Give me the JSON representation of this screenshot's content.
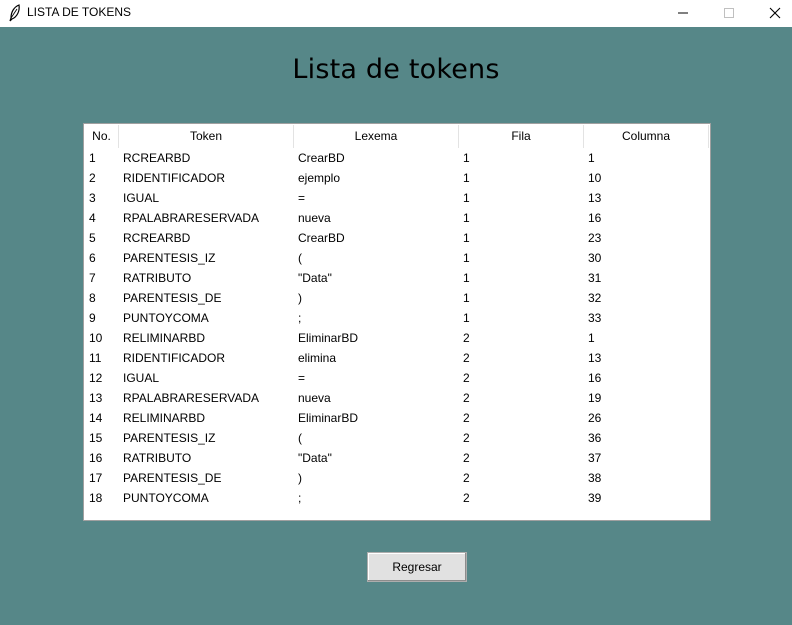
{
  "window": {
    "title": "LISTA DE TOKENS"
  },
  "heading": "Lista de tokens",
  "table": {
    "columns": [
      "No.",
      "Token",
      "Lexema",
      "Fila",
      "Columna"
    ],
    "rows": [
      [
        "1",
        "RCREARBD",
        "CrearBD",
        "1",
        "1"
      ],
      [
        "2",
        "RIDENTIFICADOR",
        "ejemplo",
        "1",
        "10"
      ],
      [
        "3",
        "IGUAL",
        "=",
        "1",
        "13"
      ],
      [
        "4",
        "RPALABRARESERVADA",
        "nueva",
        "1",
        "16"
      ],
      [
        "5",
        "RCREARBD",
        "CrearBD",
        "1",
        "23"
      ],
      [
        "6",
        "PARENTESIS_IZ",
        "(",
        "1",
        "30"
      ],
      [
        "7",
        "RATRIBUTO",
        "\"Data\"",
        "1",
        "31"
      ],
      [
        "8",
        "PARENTESIS_DE",
        ")",
        "1",
        "32"
      ],
      [
        "9",
        "PUNTOYCOMA",
        ";",
        "1",
        "33"
      ],
      [
        "10",
        "RELIMINARBD",
        "EliminarBD",
        "2",
        "1"
      ],
      [
        "11",
        "RIDENTIFICADOR",
        "elimina",
        "2",
        "13"
      ],
      [
        "12",
        "IGUAL",
        "=",
        "2",
        "16"
      ],
      [
        "13",
        "RPALABRARESERVADA",
        "nueva",
        "2",
        "19"
      ],
      [
        "14",
        "RELIMINARBD",
        "EliminarBD",
        "2",
        "26"
      ],
      [
        "15",
        "PARENTESIS_IZ",
        "(",
        "2",
        "36"
      ],
      [
        "16",
        "RATRIBUTO",
        "\"Data\"",
        "2",
        "37"
      ],
      [
        "17",
        "PARENTESIS_DE",
        ")",
        "2",
        "38"
      ],
      [
        "18",
        "PUNTOYCOMA",
        ";",
        "2",
        "39"
      ]
    ]
  },
  "back_button": "Regresar",
  "icons": {
    "app": "feather-icon",
    "minimize": "minimize-icon",
    "maximize": "maximize-icon",
    "close": "close-icon"
  },
  "colors": {
    "background": "#568788",
    "table_bg": "#ffffff",
    "button_bg": "#e1e1e1"
  }
}
